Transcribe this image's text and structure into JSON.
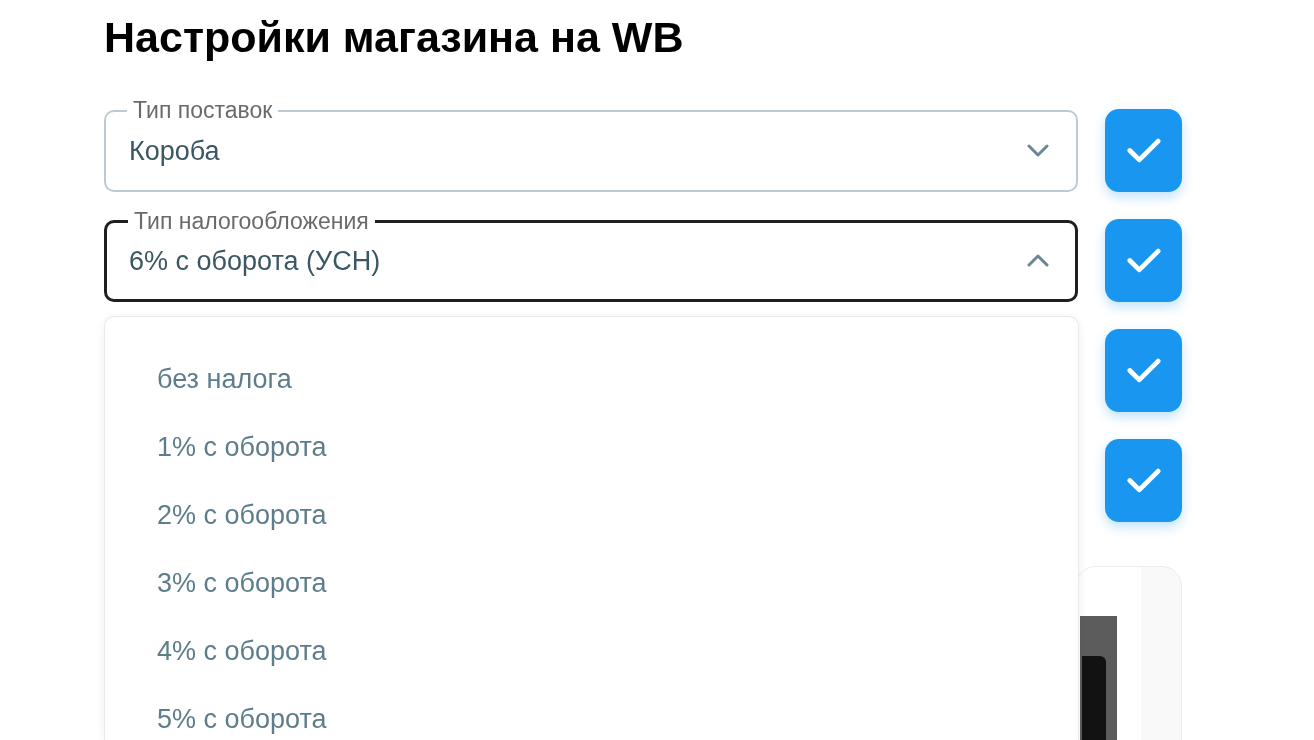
{
  "page": {
    "title": "Настройки магазина на WB"
  },
  "fields": [
    {
      "label": "Тип поставок",
      "value": "Короба",
      "expanded": false
    },
    {
      "label": "Тип налогообложения",
      "value": "6% с оборота (УСН)",
      "expanded": true,
      "options": [
        {
          "label": "без налога",
          "selected": false
        },
        {
          "label": "1% с оборота",
          "selected": false
        },
        {
          "label": "2% с оборота",
          "selected": false
        },
        {
          "label": "3% с оборота",
          "selected": false
        },
        {
          "label": "4% с оборота",
          "selected": false
        },
        {
          "label": "5% с оборота",
          "selected": false
        }
      ]
    }
  ],
  "confirm_buttons": [
    {
      "disabled": false
    },
    {
      "disabled": false
    },
    {
      "disabled": false
    },
    {
      "disabled": false
    }
  ]
}
